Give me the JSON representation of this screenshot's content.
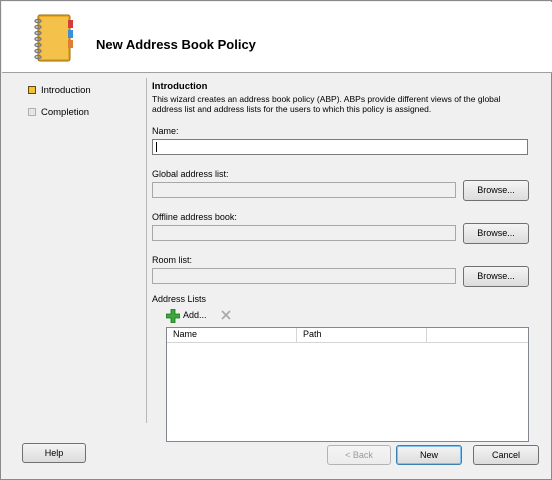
{
  "header": {
    "title": "New Address Book Policy",
    "icon": "address-book-icon"
  },
  "steps": [
    {
      "label": "Introduction",
      "state": "active"
    },
    {
      "label": "Completion",
      "state": "inactive"
    }
  ],
  "intro": {
    "title": "Introduction",
    "description": "This wizard creates an address book policy (ABP). ABPs provide different views of the global address list and address lists for the users to which this policy is assigned."
  },
  "fields": {
    "name": {
      "label": "Name:",
      "value": ""
    },
    "gal": {
      "label": "Global address list:",
      "value": "",
      "button": "Browse..."
    },
    "oab": {
      "label": "Offline address book:",
      "value": "",
      "button": "Browse..."
    },
    "room": {
      "label": "Room list:",
      "value": "",
      "button": "Browse..."
    }
  },
  "address_lists": {
    "label": "Address Lists",
    "add_label": "Add...",
    "columns": [
      "Name",
      "Path"
    ],
    "rows": []
  },
  "footer": {
    "help": "Help",
    "back": "< Back",
    "next": "New",
    "cancel": "Cancel"
  },
  "colors": {
    "accent": "#3c7fb1",
    "active_step": "#f2c230",
    "add_icon": "#3aa83a"
  }
}
